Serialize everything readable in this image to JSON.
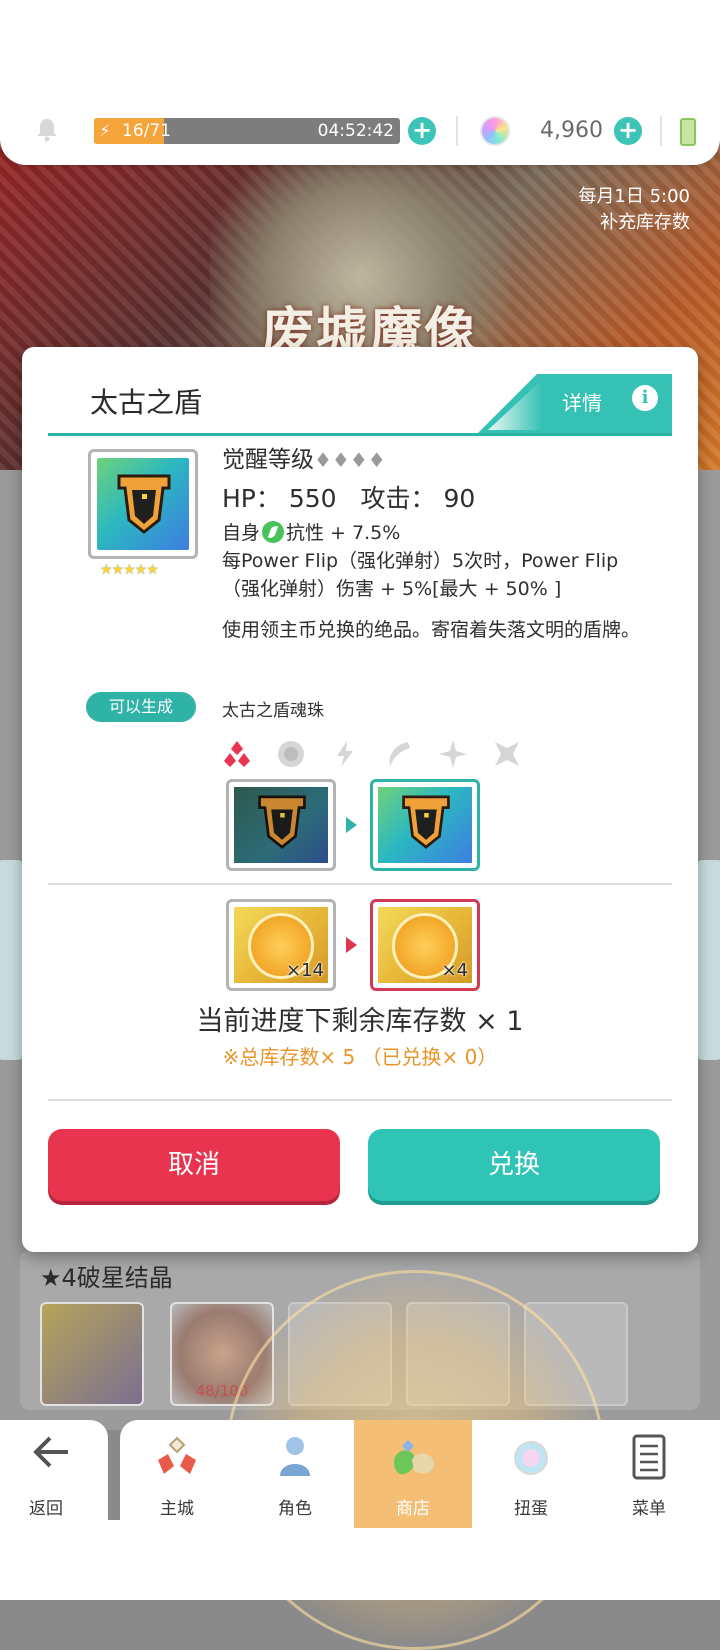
{
  "status_bar": {
    "energy": "16/71",
    "energy_fraction": 0.23,
    "energy_timer": "04:52:42",
    "gems": "4,960"
  },
  "banner": {
    "title": "废墟魔像",
    "refresh_line1": "每月1日 5:00",
    "refresh_line2": "补充库存数"
  },
  "modal": {
    "item_name": "太古之盾",
    "detail_label": "详情",
    "rarity": "★★★★★",
    "awaken_label": "觉醒等级",
    "awaken_gems": "♦♦♦♦",
    "hp_label": "HP：",
    "hp_value": "550",
    "atk_label": "攻击：",
    "atk_value": "90",
    "effect_prefix": "自身",
    "effect_text": "抗性 + 7.5%",
    "skill_desc": "每Power Flip（强化弹射）5次时，Power Flip（强化弹射）伤害 + 5%[最大 + 50% ]",
    "flavor": "使用领主币兑换的绝品。寄宿着失落文明的盾牌。",
    "generate_badge": "可以生成",
    "generate_item": "太古之盾魂珠",
    "cost_owned_qty": "×14",
    "cost_required_qty": "×4",
    "stock_line": "当前进度下剩余库存数 × 1",
    "stock_note": "※总库存数× 5 （已兑换× 0）",
    "cancel_label": "取消",
    "exchange_label": "兑换"
  },
  "star_section": {
    "title": "★4破星结晶",
    "count": "48/100"
  },
  "nav": {
    "back": "返回",
    "items": [
      "主城",
      "角色",
      "商店",
      "扭蛋",
      "菜单"
    ]
  },
  "colors": {
    "accent_teal": "#2fb3a7",
    "cancel_red": "#e8344f",
    "note_orange": "#e8962a"
  }
}
